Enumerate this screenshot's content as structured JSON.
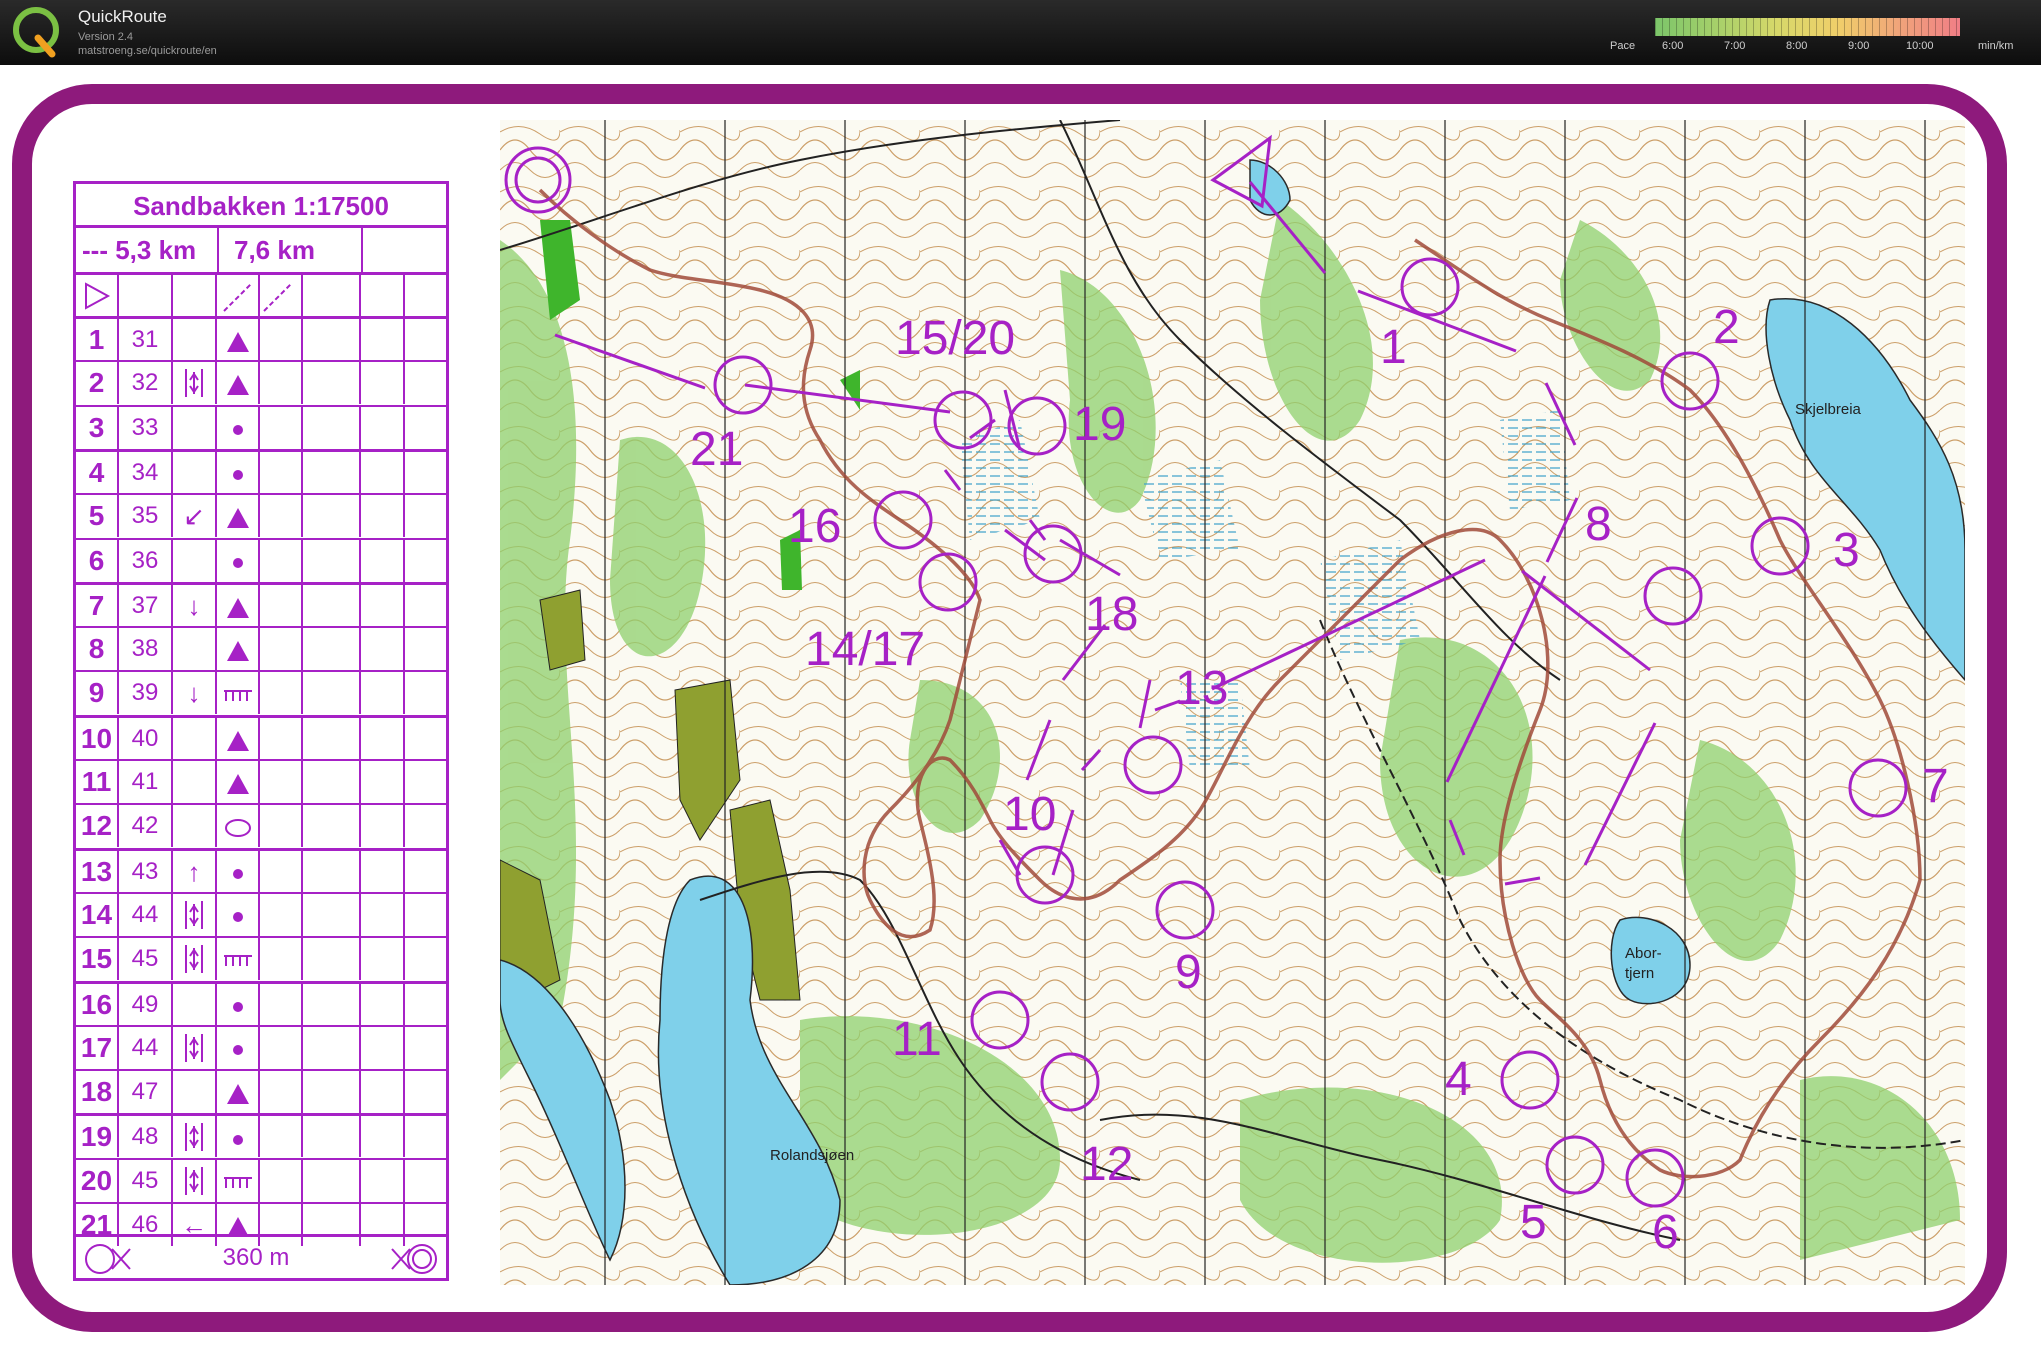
{
  "app": {
    "title": "QuickRoute",
    "version": "Version 2.4",
    "url": "matstroeng.se/quickroute/en",
    "logo_icon": "quickroute-q-logo"
  },
  "pace_legend": {
    "label": "Pace",
    "ticks": [
      "6:00",
      "7:00",
      "8:00",
      "9:00",
      "10:00"
    ],
    "unit": "min/km"
  },
  "control_descriptions": {
    "title": "Sandbakken 1:17500",
    "length_text": "--- 5,3 km",
    "length_text_2": "7,6 km",
    "start_symbol": "start-triangle-icon",
    "rows": [
      {
        "num": "1",
        "code": "31",
        "dir": "",
        "symbol": "triangle"
      },
      {
        "num": "2",
        "code": "32",
        "dir": "between",
        "symbol": "triangle"
      },
      {
        "num": "3",
        "code": "33",
        "dir": "",
        "symbol": "dot"
      },
      {
        "num": "4",
        "code": "34",
        "dir": "",
        "symbol": "dot"
      },
      {
        "num": "5",
        "code": "35",
        "dir": "↙",
        "symbol": "triangle"
      },
      {
        "num": "6",
        "code": "36",
        "dir": "",
        "symbol": "dot"
      },
      {
        "num": "7",
        "code": "37",
        "dir": "↓",
        "symbol": "triangle"
      },
      {
        "num": "8",
        "code": "38",
        "dir": "",
        "symbol": "triangle"
      },
      {
        "num": "9",
        "code": "39",
        "dir": "↓",
        "symbol": "ruined"
      },
      {
        "num": "10",
        "code": "40",
        "dir": "",
        "symbol": "triangle"
      },
      {
        "num": "11",
        "code": "41",
        "dir": "",
        "symbol": "triangle"
      },
      {
        "num": "12",
        "code": "42",
        "dir": "",
        "symbol": "ellipse"
      },
      {
        "num": "13",
        "code": "43",
        "dir": "↑",
        "symbol": "dot"
      },
      {
        "num": "14",
        "code": "44",
        "dir": "between",
        "symbol": "dot"
      },
      {
        "num": "15",
        "code": "45",
        "dir": "between",
        "symbol": "ruined"
      },
      {
        "num": "16",
        "code": "49",
        "dir": "",
        "symbol": "dot"
      },
      {
        "num": "17",
        "code": "44",
        "dir": "between",
        "symbol": "dot"
      },
      {
        "num": "18",
        "code": "47",
        "dir": "",
        "symbol": "triangle"
      },
      {
        "num": "19",
        "code": "48",
        "dir": "between",
        "symbol": "dot"
      },
      {
        "num": "20",
        "code": "45",
        "dir": "between",
        "symbol": "ruined"
      },
      {
        "num": "21",
        "code": "46",
        "dir": "←",
        "symbol": "triangle"
      }
    ],
    "finish_text": "360 m"
  },
  "map": {
    "control_labels": [
      {
        "text": "1"
      },
      {
        "text": "2"
      },
      {
        "text": "3"
      },
      {
        "text": "4"
      },
      {
        "text": "5"
      },
      {
        "text": "6"
      },
      {
        "text": "7"
      },
      {
        "text": "8"
      },
      {
        "text": "9"
      },
      {
        "text": "10"
      },
      {
        "text": "11"
      },
      {
        "text": "12"
      },
      {
        "text": "13"
      },
      {
        "text": "14/17"
      },
      {
        "text": "15/20"
      },
      {
        "text": "16"
      },
      {
        "text": "18"
      },
      {
        "text": "19"
      },
      {
        "text": "21"
      }
    ],
    "place_names": {
      "lake_1": "Rolandsjøen",
      "lake_2": "Skjelbreia",
      "lake_3_line1": "Abor-",
      "lake_3_line2": "tjern"
    },
    "colors": {
      "course": "#a621c6",
      "route": "#a04a3a",
      "frame": "#8e1a7c",
      "water": "#7fd0ea",
      "open_land": "#7cc657",
      "forest": "#ffffff",
      "contour": "#b8864a"
    }
  }
}
